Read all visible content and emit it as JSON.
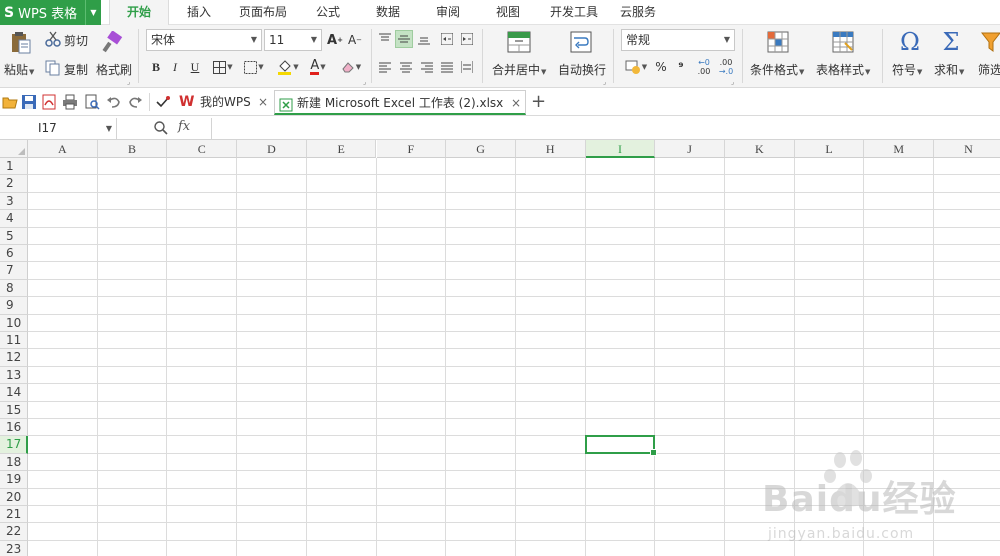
{
  "app": {
    "name": "WPS 表格"
  },
  "menu": {
    "tabs": [
      "开始",
      "插入",
      "页面布局",
      "公式",
      "数据",
      "审阅",
      "视图",
      "开发工具",
      "云服务"
    ],
    "active_index": 0
  },
  "ribbon": {
    "paste": "粘贴",
    "cut": "剪切",
    "copy": "复制",
    "format_painter": "格式刷",
    "font_name": "宋体",
    "font_size": "11",
    "bold": "B",
    "italic": "I",
    "underline": "U",
    "merge_center": "合并居中",
    "wrap_text": "自动换行",
    "number_format": "常规",
    "percent": "%",
    "thousands": "⁹",
    "dec_inc": ".00",
    "dec_dec": ".0",
    "conditional_format": "条件格式",
    "table_style": "表格样式",
    "symbol": "符号",
    "sum": "求和",
    "filter": "筛选"
  },
  "doc_tabs": [
    {
      "label": "我的WPS",
      "active": false
    },
    {
      "label": "新建 Microsoft Excel 工作表 (2).xlsx",
      "active": true
    }
  ],
  "formula_bar": {
    "name_box": "I17",
    "fx": "fx",
    "value": ""
  },
  "sheet": {
    "columns": [
      "A",
      "B",
      "C",
      "D",
      "E",
      "F",
      "G",
      "H",
      "I",
      "J",
      "K",
      "L",
      "M",
      "N"
    ],
    "rows": [
      "1",
      "2",
      "3",
      "4",
      "5",
      "6",
      "7",
      "8",
      "9",
      "10",
      "11",
      "12",
      "13",
      "14",
      "15",
      "16",
      "17",
      "18",
      "19",
      "20",
      "21",
      "22",
      "23"
    ],
    "active_cell": {
      "col": "I",
      "row": "17"
    }
  },
  "watermark": {
    "brand": "Baidu经验",
    "url": "jingyan.baidu.com"
  },
  "colors": {
    "accent": "#2f9e48",
    "ribbon_bg": "#f4f4f4",
    "grid_line": "#dcdcdc"
  }
}
